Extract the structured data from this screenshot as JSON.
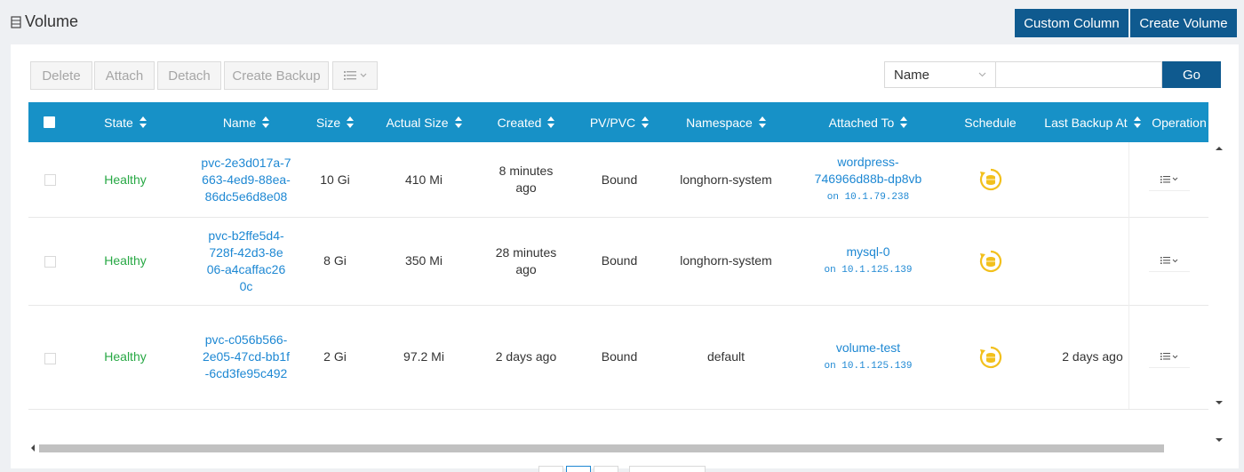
{
  "page": {
    "title": "Volume",
    "custom_column_label": "Custom Column",
    "create_volume_label": "Create Volume"
  },
  "toolbar": {
    "delete_label": "Delete",
    "attach_label": "Attach",
    "detach_label": "Detach",
    "create_backup_label": "Create Backup",
    "menu_icon": "list-menu-icon"
  },
  "search": {
    "field_selected": "Name",
    "value": "",
    "go_label": "Go"
  },
  "table": {
    "headers": {
      "state": "State",
      "name": "Name",
      "size": "Size",
      "actual_size": "Actual Size",
      "created": "Created",
      "pv_pvc": "PV/PVC",
      "namespace": "Namespace",
      "attached_to": "Attached To",
      "schedule": "Schedule",
      "last_backup": "Last Backup At",
      "operation": "Operation"
    },
    "rows": [
      {
        "state": "Healthy",
        "name": "pvc-2e3d017a-7663-4ed9-88ea-86dc5e6d8e08",
        "size": "10 Gi",
        "actual_size": "410 Mi",
        "created": "8 minutes ago",
        "pv_pvc": "Bound",
        "namespace": "longhorn-system",
        "attached_to": "wordpress-746966d88b-dp8vb",
        "attached_ip": "on 10.1.79.238",
        "last_backup": ""
      },
      {
        "state": "Healthy",
        "name": "pvc-b2ffe5d4-728f-42d3-8e06-a4caffac260c",
        "size": "8 Gi",
        "actual_size": "350 Mi",
        "created": "28 minutes ago",
        "pv_pvc": "Bound",
        "namespace": "longhorn-system",
        "attached_to": "mysql-0",
        "attached_ip": "on 10.1.125.139",
        "last_backup": ""
      },
      {
        "state": "Healthy",
        "name": "pvc-c056b566-2e05-47cd-bb1f-6cd3fe95c492",
        "size": "2 Gi",
        "actual_size": "97.2 Mi",
        "created": "2 days ago",
        "pv_pvc": "Bound",
        "namespace": "default",
        "attached_to": "volume-test",
        "attached_ip": "on 10.1.125.139",
        "last_backup": "2 days ago"
      }
    ]
  },
  "colors": {
    "brand": "#0f5a8f",
    "header": "#1791c7",
    "healthy": "#27a844",
    "link": "#1e88d3",
    "schedule_icon": "#f2c01c"
  }
}
